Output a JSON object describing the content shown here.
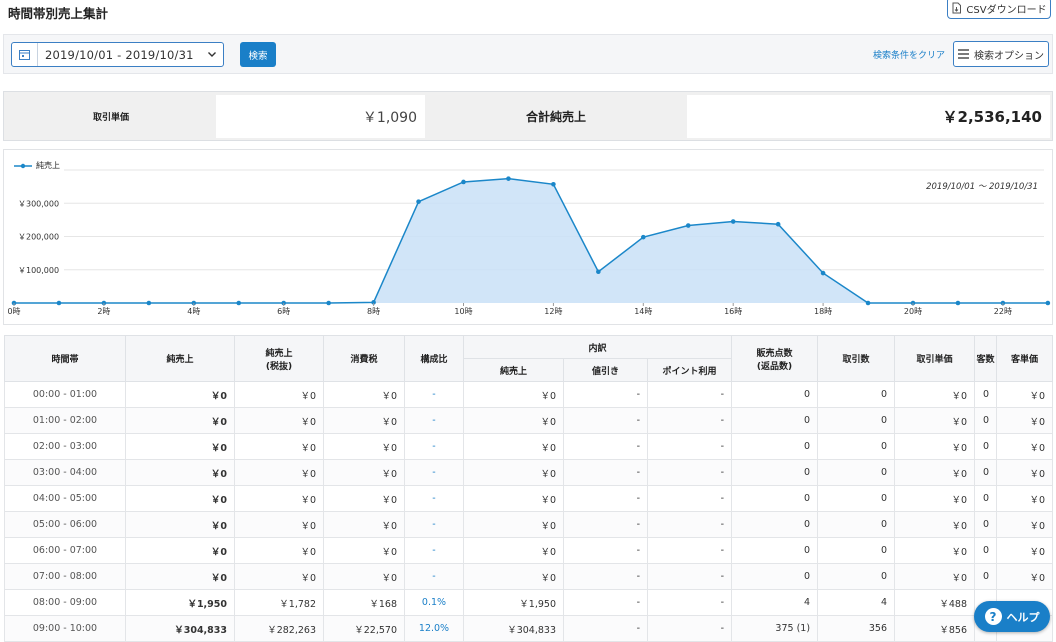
{
  "page": {
    "title": "時間帯別売上集計"
  },
  "header": {
    "csv_label": "CSVダウンロード"
  },
  "search": {
    "date_range": "2019/10/01 - 2019/10/31",
    "search_label": "検索",
    "clear_label": "検索条件をクリア",
    "options_label": "検索オプション"
  },
  "summary": {
    "unit_price_label": "取引単価",
    "unit_price_value": "￥1,090",
    "total_label": "合計純売上",
    "total_value": "￥2,536,140"
  },
  "chart_data": {
    "type": "area",
    "legend": [
      "純売上"
    ],
    "period": "2019/10/01 ～ 2019/10/31",
    "x": [
      "0時",
      "1時",
      "2時",
      "3時",
      "4時",
      "5時",
      "6時",
      "7時",
      "8時",
      "9時",
      "10時",
      "11時",
      "12時",
      "13時",
      "14時",
      "15時",
      "16時",
      "17時",
      "18時",
      "19時",
      "20時",
      "21時",
      "22時",
      "23時"
    ],
    "x_tick_labels": [
      "0時",
      "2時",
      "4時",
      "6時",
      "8時",
      "10時",
      "12時",
      "14時",
      "16時",
      "18時",
      "20時",
      "22時"
    ],
    "y_tick_labels": [
      "￥100,000",
      "￥200,000",
      "￥300,000"
    ],
    "ylim": [
      0,
      400000
    ],
    "series": [
      {
        "name": "純売上",
        "values": [
          0,
          0,
          0,
          0,
          0,
          0,
          0,
          0,
          1950,
          304833,
          364000,
          374000,
          357000,
          94000,
          198000,
          233000,
          245000,
          237000,
          90000,
          0,
          0,
          0,
          0,
          0
        ]
      }
    ],
    "colors": {
      "line": "#1b87c9",
      "fill": "#c9e1f7",
      "grid": "#e6e6e6"
    }
  },
  "table": {
    "headers": {
      "time": "時間帯",
      "net": "純売上",
      "net_ex_tax_1": "純売上",
      "net_ex_tax_2": "(税抜)",
      "tax": "消費税",
      "ratio": "構成比",
      "breakdown": "内訳",
      "bd_net": "純売上",
      "bd_discount": "値引き",
      "bd_point": "ポイント利用",
      "items_1": "販売点数",
      "items_2": "(返品数)",
      "transactions": "取引数",
      "unit_price": "取引単価",
      "customers": "客数",
      "customer_price": "客単価"
    },
    "rows": [
      [
        "00:00 - 01:00",
        "￥0",
        "￥0",
        "￥0",
        "-",
        "￥0",
        "-",
        "-",
        "0",
        "0",
        "￥0",
        "0",
        "￥0"
      ],
      [
        "01:00 - 02:00",
        "￥0",
        "￥0",
        "￥0",
        "-",
        "￥0",
        "-",
        "-",
        "0",
        "0",
        "￥0",
        "0",
        "￥0"
      ],
      [
        "02:00 - 03:00",
        "￥0",
        "￥0",
        "￥0",
        "-",
        "￥0",
        "-",
        "-",
        "0",
        "0",
        "￥0",
        "0",
        "￥0"
      ],
      [
        "03:00 - 04:00",
        "￥0",
        "￥0",
        "￥0",
        "-",
        "￥0",
        "-",
        "-",
        "0",
        "0",
        "￥0",
        "0",
        "￥0"
      ],
      [
        "04:00 - 05:00",
        "￥0",
        "￥0",
        "￥0",
        "-",
        "￥0",
        "-",
        "-",
        "0",
        "0",
        "￥0",
        "0",
        "￥0"
      ],
      [
        "05:00 - 06:00",
        "￥0",
        "￥0",
        "￥0",
        "-",
        "￥0",
        "-",
        "-",
        "0",
        "0",
        "￥0",
        "0",
        "￥0"
      ],
      [
        "06:00 - 07:00",
        "￥0",
        "￥0",
        "￥0",
        "-",
        "￥0",
        "-",
        "-",
        "0",
        "0",
        "￥0",
        "0",
        "￥0"
      ],
      [
        "07:00 - 08:00",
        "￥0",
        "￥0",
        "￥0",
        "-",
        "￥0",
        "-",
        "-",
        "0",
        "0",
        "￥0",
        "0",
        "￥0"
      ],
      [
        "08:00 - 09:00",
        "￥1,950",
        "￥1,782",
        "￥168",
        "0.1%",
        "￥1,950",
        "-",
        "-",
        "4",
        "4",
        "￥488",
        "",
        ""
      ],
      [
        "09:00 - 10:00",
        "￥304,833",
        "￥282,263",
        "￥22,570",
        "12.0%",
        "￥304,833",
        "-",
        "-",
        "375 (1)",
        "356",
        "￥856",
        "",
        ""
      ]
    ]
  },
  "help": {
    "label": "ヘルプ",
    "icon": "?"
  }
}
